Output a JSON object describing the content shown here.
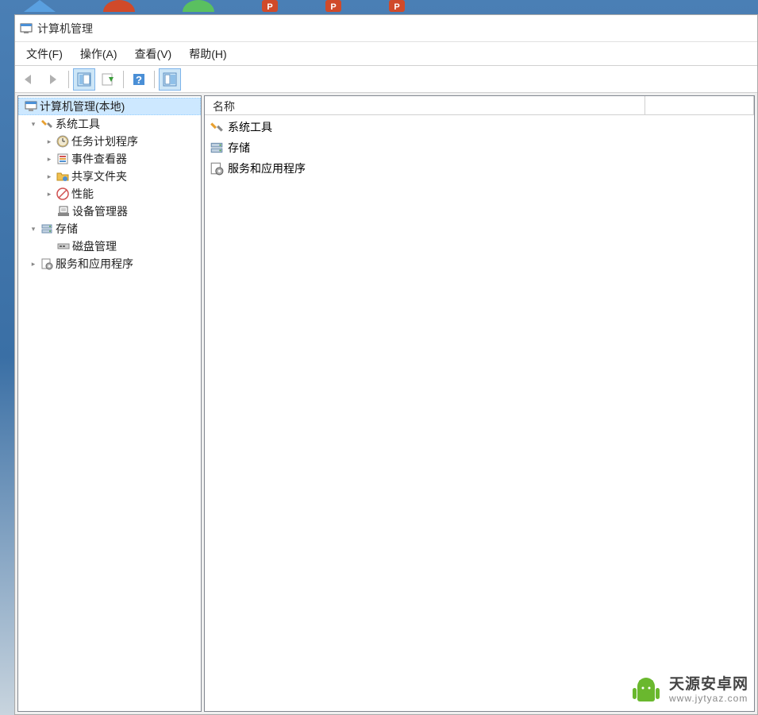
{
  "window": {
    "title": "计算机管理"
  },
  "menubar": [
    "文件(F)",
    "操作(A)",
    "查看(V)",
    "帮助(H)"
  ],
  "tree": {
    "root": {
      "label": "计算机管理(本地)",
      "expanded": true,
      "children": [
        {
          "label": "系统工具",
          "expanded": true,
          "icon": "tools",
          "children": [
            {
              "label": "任务计划程序",
              "icon": "clock",
              "expandable": true
            },
            {
              "label": "事件查看器",
              "icon": "event",
              "expandable": true
            },
            {
              "label": "共享文件夹",
              "icon": "shared",
              "expandable": true
            },
            {
              "label": "性能",
              "icon": "perf",
              "expandable": true
            },
            {
              "label": "设备管理器",
              "icon": "device",
              "expandable": false
            }
          ]
        },
        {
          "label": "存储",
          "expanded": true,
          "icon": "storage",
          "children": [
            {
              "label": "磁盘管理",
              "icon": "disk",
              "expandable": false
            }
          ]
        },
        {
          "label": "服务和应用程序",
          "expanded": false,
          "icon": "services",
          "expandable": true
        }
      ]
    }
  },
  "list": {
    "header": "名称",
    "items": [
      {
        "label": "系统工具",
        "icon": "tools"
      },
      {
        "label": "存储",
        "icon": "storage"
      },
      {
        "label": "服务和应用程序",
        "icon": "services"
      }
    ]
  },
  "watermark": {
    "title": "天源安卓网",
    "url": "www.jytyaz.com"
  }
}
